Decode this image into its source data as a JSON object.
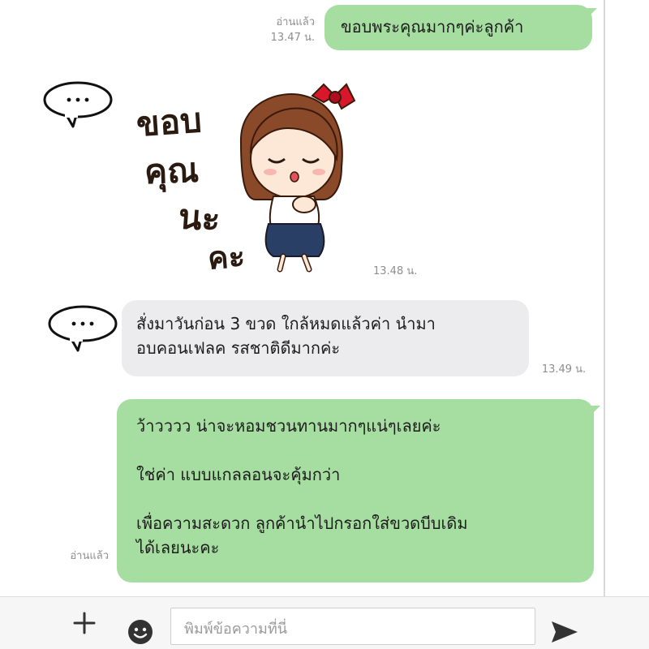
{
  "messages": [
    {
      "direction": "out",
      "read_label": "อ่านแล้ว",
      "time": "13.47 น.",
      "lines": [
        "ขอบพระคุณมากๆค่ะลูกค้า"
      ]
    },
    {
      "direction": "in",
      "type": "sticker",
      "sticker_text": [
        "ขอบ",
        "คุณ",
        "นะ",
        "คะ"
      ],
      "time": "13.48 น."
    },
    {
      "direction": "in",
      "time": "13.49 น.",
      "lines": [
        "สั่งมาวันก่อน 3 ขวด ใกล้หมดแล้วค่า  นำมา",
        "อบคอนเฟลค รสชาติดีมากค่ะ"
      ]
    },
    {
      "direction": "out",
      "read_label": "อ่านแล้ว",
      "lines": [
        "ว้าวววว น่าจะหอมชวนทานมากๆแน่ๆเลยค่ะ",
        "",
        "ใช่ค่า แบบแกลลอนจะคุ้มกว่า",
        "",
        "เพื่อความสะดวก ลูกค้านำไปกรอกใส่ขวดบีบเดิม",
        "ได้เลยนะคะ"
      ]
    }
  ],
  "composer": {
    "placeholder": "พิมพ์ข้อความที่นี่"
  },
  "icons": {
    "add": "plus-icon",
    "emoji": "smiley-icon",
    "send": "send-icon",
    "avatar": "thought-bubble-icon"
  },
  "colors": {
    "outgoing_bubble": "#a6dea1",
    "incoming_bubble": "#ececef",
    "meta_text": "#8e8e8e"
  }
}
